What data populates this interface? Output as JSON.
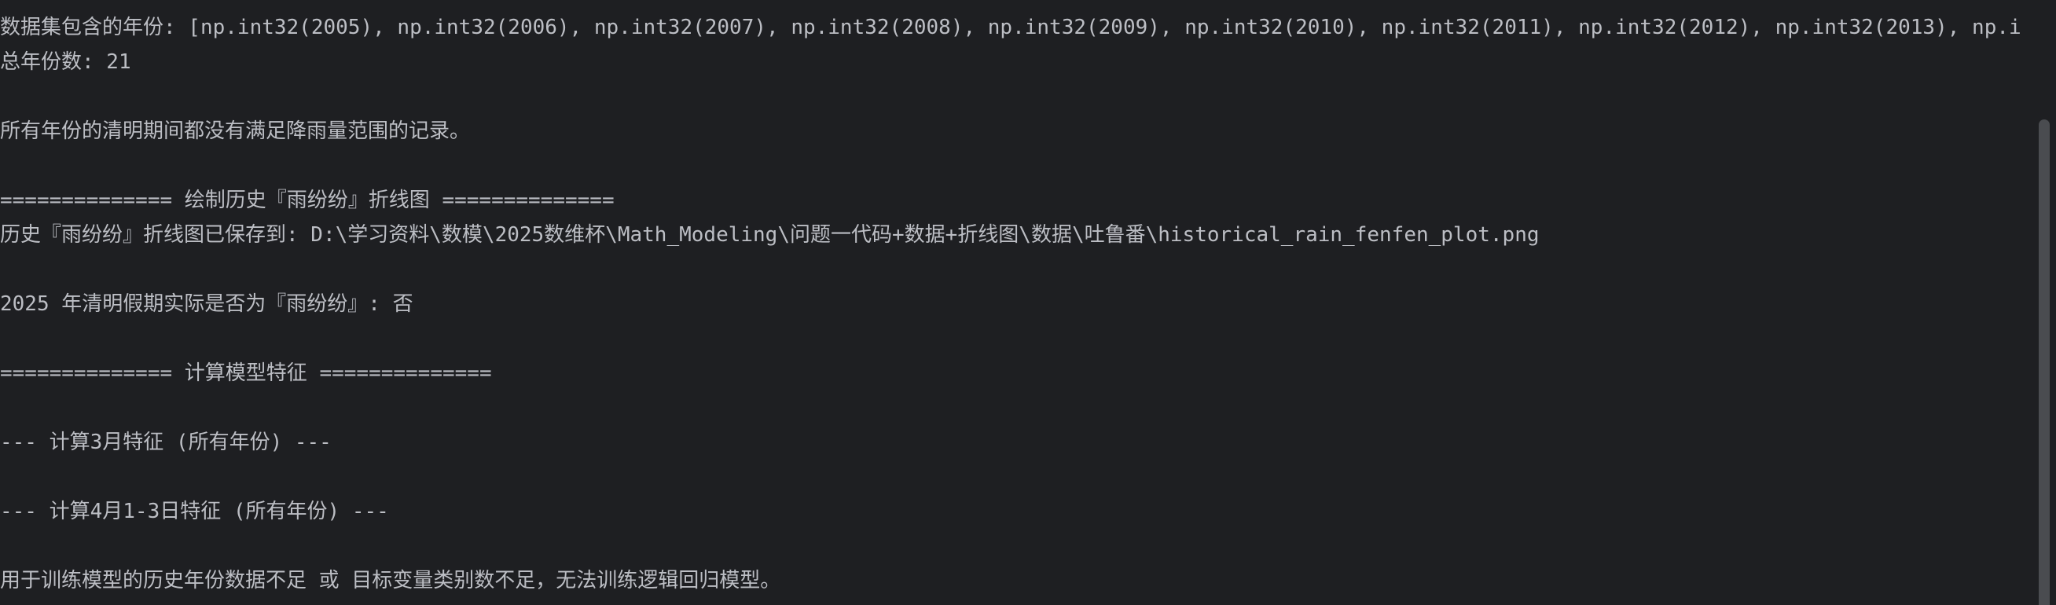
{
  "console": {
    "lines": [
      "数据集包含的年份: [np.int32(2005), np.int32(2006), np.int32(2007), np.int32(2008), np.int32(2009), np.int32(2010), np.int32(2011), np.int32(2012), np.int32(2013), np.i",
      "总年份数: 21",
      "",
      "所有年份的清明期间都没有满足降雨量范围的记录。",
      "",
      "============== 绘制历史『雨纷纷』折线图 ==============",
      "历史『雨纷纷』折线图已保存到: D:\\学习资料\\数模\\2025数维杯\\Math_Modeling\\问题一代码+数据+折线图\\数据\\吐鲁番\\historical_rain_fenfen_plot.png",
      "",
      "2025 年清明假期实际是否为『雨纷纷』: 否",
      "",
      "============== 计算模型特征 ==============",
      "",
      "--- 计算3月特征 (所有年份) ---",
      "",
      "--- 计算4月1-3日特征 (所有年份) ---",
      "",
      "用于训练模型的历史年份数据不足 或 目标变量类别数不足，无法训练逻辑回归模型。"
    ]
  },
  "colors": {
    "background": "#1e1f22",
    "text": "#bcbec4",
    "scrollbar_thumb": "#4a4c50"
  }
}
